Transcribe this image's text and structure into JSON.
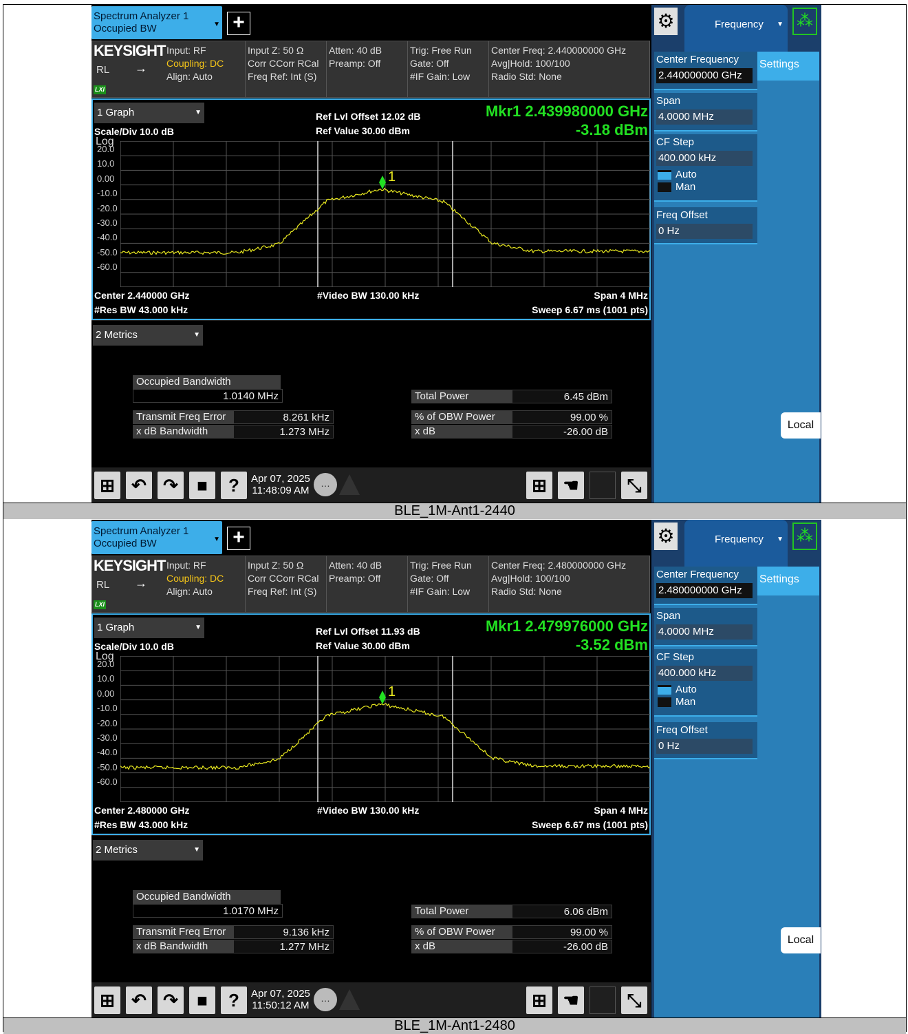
{
  "panels": [
    {
      "caption": "BLE_1M-Ant1-2440",
      "tab": {
        "line1": "Spectrum Analyzer 1",
        "line2": "Occupied BW"
      },
      "brand": "KEYSIGHT",
      "rl": "RL",
      "lxi": "LXI",
      "info": {
        "col1": [
          "Input: RF",
          "Coupling: DC",
          "Align: Auto"
        ],
        "col2": [
          "Input Z: 50 Ω",
          "Corr CCorr RCal",
          "Freq Ref: Int (S)"
        ],
        "col3": [
          "Atten: 40 dB",
          "Preamp: Off"
        ],
        "col4": [
          "Trig: Free Run",
          "Gate: Off",
          "#IF Gain: Low"
        ],
        "col5": [
          "Center Freq: 2.440000000 GHz",
          "Avg|Hold: 100/100",
          "Radio Std: None"
        ]
      },
      "graph": {
        "view": "1 Graph",
        "scale": "Scale/Div 10.0 dB",
        "log": "Log",
        "offset": "Ref Lvl Offset 12.02 dB",
        "refval": "Ref Value 30.00 dBm",
        "mkr_freq": "Mkr1  2.439980000 GHz",
        "mkr_amp": "-3.18 dBm",
        "marker_label": "1",
        "ticks": [
          "20.0",
          "10.0",
          "0.00",
          "-10.0",
          "-20.0",
          "-30.0",
          "-40.0",
          "-50.0",
          "-60.0"
        ],
        "center": "Center 2.440000 GHz",
        "rbw": "#Res BW 43.000 kHz",
        "vbw": "#Video BW 130.00 kHz",
        "span": "Span 4 MHz",
        "sweep": "Sweep 6.67 ms (1001 pts)"
      },
      "metrics": {
        "view": "2 Metrics",
        "obw_label": "Occupied Bandwidth",
        "obw_value": "1.0140 MHz",
        "tfe_label": "Transmit Freq Error",
        "tfe_value": "8.261 kHz",
        "xdb_label": "x dB Bandwidth",
        "xdb_value": "1.273 MHz",
        "tp_label": "Total Power",
        "tp_value": "6.45 dBm",
        "pct_label": "% of OBW Power",
        "pct_value": "99.00 %",
        "xd_label": "x dB",
        "xd_value": "-26.00 dB"
      },
      "taskbar": {
        "date": "Apr 07, 2025",
        "time": "11:48:09 AM"
      },
      "side": {
        "menu": "Frequency",
        "settings": "Settings",
        "cf_label": "Center Frequency",
        "cf_value": "2.440000000 GHz",
        "span_label": "Span",
        "span_value": "4.0000 MHz",
        "cfstep_label": "CF Step",
        "cfstep_value": "400.000 kHz",
        "auto": "Auto",
        "man": "Man",
        "offset_label": "Freq Offset",
        "offset_value": "0 Hz",
        "local": "Local"
      }
    },
    {
      "caption": "BLE_1M-Ant1-2480",
      "tab": {
        "line1": "Spectrum Analyzer 1",
        "line2": "Occupied BW"
      },
      "brand": "KEYSIGHT",
      "rl": "RL",
      "lxi": "LXI",
      "info": {
        "col1": [
          "Input: RF",
          "Coupling: DC",
          "Align: Auto"
        ],
        "col2": [
          "Input Z: 50 Ω",
          "Corr CCorr RCal",
          "Freq Ref: Int (S)"
        ],
        "col3": [
          "Atten: 40 dB",
          "Preamp: Off"
        ],
        "col4": [
          "Trig: Free Run",
          "Gate: Off",
          "#IF Gain: Low"
        ],
        "col5": [
          "Center Freq: 2.480000000 GHz",
          "Avg|Hold: 100/100",
          "Radio Std: None"
        ]
      },
      "graph": {
        "view": "1 Graph",
        "scale": "Scale/Div 10.0 dB",
        "log": "Log",
        "offset": "Ref Lvl Offset 11.93 dB",
        "refval": "Ref Value 30.00 dBm",
        "mkr_freq": "Mkr1  2.479976000 GHz",
        "mkr_amp": "-3.52 dBm",
        "marker_label": "1",
        "ticks": [
          "20.0",
          "10.0",
          "0.00",
          "-10.0",
          "-20.0",
          "-30.0",
          "-40.0",
          "-50.0",
          "-60.0"
        ],
        "center": "Center 2.480000 GHz",
        "rbw": "#Res BW 43.000 kHz",
        "vbw": "#Video BW 130.00 kHz",
        "span": "Span 4 MHz",
        "sweep": "Sweep 6.67 ms (1001 pts)"
      },
      "metrics": {
        "view": "2 Metrics",
        "obw_label": "Occupied Bandwidth",
        "obw_value": "1.0170 MHz",
        "tfe_label": "Transmit Freq Error",
        "tfe_value": "9.136 kHz",
        "xdb_label": "x dB Bandwidth",
        "xdb_value": "1.277 MHz",
        "tp_label": "Total Power",
        "tp_value": "6.06 dBm",
        "pct_label": "% of OBW Power",
        "pct_value": "99.00 %",
        "xd_label": "x dB",
        "xd_value": "-26.00 dB"
      },
      "taskbar": {
        "date": "Apr 07, 2025",
        "time": "11:50:12 AM"
      },
      "side": {
        "menu": "Frequency",
        "settings": "Settings",
        "cf_label": "Center Frequency",
        "cf_value": "2.480000000 GHz",
        "span_label": "Span",
        "span_value": "4.0000 MHz",
        "cfstep_label": "CF Step",
        "cfstep_value": "400.000 kHz",
        "auto": "Auto",
        "man": "Man",
        "offset_label": "Freq Offset",
        "offset_value": "0 Hz",
        "local": "Local"
      }
    }
  ],
  "colors": {
    "trace": "#e8e820",
    "marker": "#22e022",
    "accent": "#3daee9",
    "panel": "#1b3f6b"
  },
  "icons": [
    "windows-icon",
    "undo-icon",
    "redo-icon",
    "folder-icon",
    "help-icon",
    "chat-icon",
    "gear-icon",
    "spinner-icon"
  ]
}
